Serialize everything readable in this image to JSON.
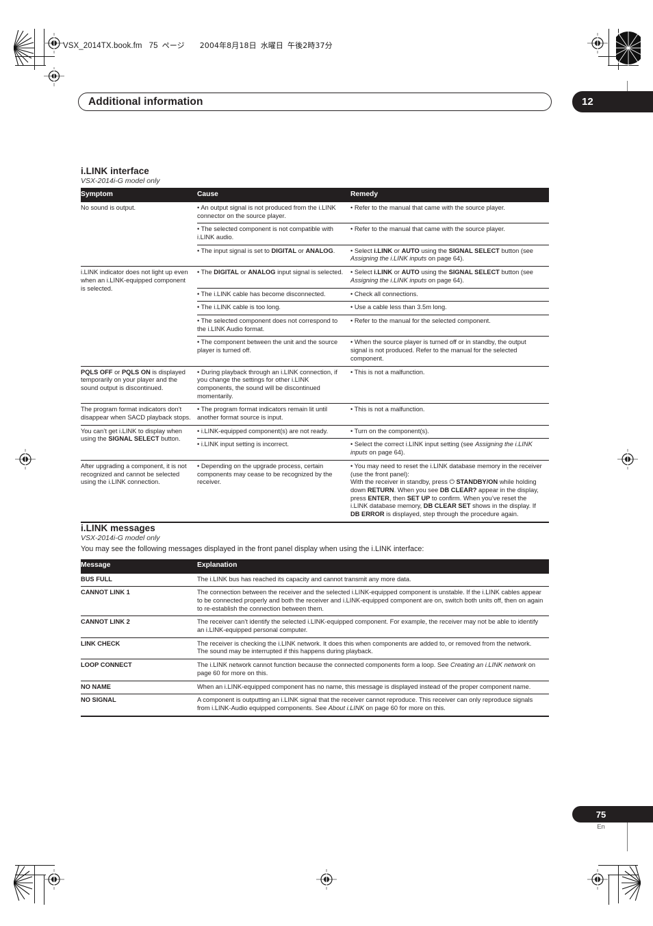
{
  "file_header": {
    "filename": "VSX_2014TX.book.fm",
    "page_label": "75",
    "page_unit": "ページ",
    "date": "2004年8月18日",
    "weekday": "水曜日",
    "time": "午後2時37分"
  },
  "chapter": {
    "title": "Additional information",
    "number": "12"
  },
  "sections": [
    {
      "heading": "i.LINK interface",
      "model_note": "VSX-2014i-G model only"
    },
    {
      "heading": "i.LINK messages",
      "model_note": "VSX-2014i-G model only",
      "lead": "You may see the following messages displayed in the front panel display when using the i.LINK interface:"
    }
  ],
  "troubleshooting_table": {
    "headers": [
      "Symptom",
      "Cause",
      "Remedy"
    ],
    "rows": [
      {
        "symptom": "No sound is output.",
        "entries": [
          {
            "cause": "• An output signal is not produced from the i.LINK connector on the source player.",
            "remedy": "• Refer to the manual that came with the source player."
          },
          {
            "cause": "• The selected component is not compatible with i.LINK audio.",
            "remedy": "• Refer to the manual that came with the source player."
          },
          {
            "cause_html": "• The input signal is set to <b>DIGITAL</b> or <b>ANALOG</b>.",
            "remedy_html": "• Select <b>i.LINK</b> or <b>AUTO</b> using the <b>SIGNAL SELECT</b> button (see <i>Assigning the i.LINK inputs</i> on page 64)."
          }
        ]
      },
      {
        "symptom": "i.LINK indicator does not light up even when an i.LINK-equipped component is selected.",
        "entries": [
          {
            "cause_html": "• The <b>DIGITAL</b> or <b>ANALOG</b> input signal is selected.",
            "remedy_html": "• Select <b>i.LINK</b> or <b>AUTO</b> using the <b>SIGNAL SELECT</b> button (see <i>Assigning the i.LINK inputs</i> on page 64)."
          },
          {
            "cause": "• The i.LINK cable has become disconnected.",
            "remedy": "• Check all connections."
          },
          {
            "cause": "• The i.LINK cable is too long.",
            "remedy": "• Use a cable less than 3.5m long."
          },
          {
            "cause": "• The selected component does not correspond to the i.LINK Audio format.",
            "remedy": "• Refer to the manual for the selected component."
          },
          {
            "cause": "• The component between the unit and the source player is turned off.",
            "remedy": "• When the source player is turned off or in standby, the output signal is not produced. Refer to the manual for the selected component."
          }
        ]
      },
      {
        "symptom_html": "<b>PQLS OFF</b> or <b>PQLS ON</b> is displayed temporarily on your player and the sound output is discontinued.",
        "entries": [
          {
            "cause": "• During playback through an i.LINK connection, if you change the settings for other i.LINK components, the sound will be discontinued momentarily.",
            "remedy": "• This is not a malfunction."
          }
        ]
      },
      {
        "symptom": "The program format indicators don’t disappear when SACD playback stops.",
        "entries": [
          {
            "cause": "• The program format indicators remain lit until another format source is input.",
            "remedy": "• This is not a malfunction."
          }
        ]
      },
      {
        "symptom_html": "You can’t get i.LINK to display when using the <b>SIGNAL SELECT</b> button.",
        "entries": [
          {
            "cause": "• i.LINK-equipped component(s) are not ready.",
            "remedy": "• Turn on the component(s)."
          },
          {
            "cause": "• i.LINK input setting is incorrect.",
            "remedy_html": "• Select the correct i.LINK input setting (see <i>Assigning the i.LINK inputs</i> on page 64)."
          }
        ]
      },
      {
        "symptom": "After upgrading a component, it is not recognized and cannot be selected using the i.LINK connection.",
        "entries": [
          {
            "cause": "• Depending on the upgrade process, certain components may cease to be recognized by the receiver.",
            "remedy_html": "• You may need to reset the i.LINK database memory in the receiver (use the front panel):<br>With the receiver in standby, press ⏻ <b>STANDBY/ON</b> while holding down <b>RETURN</b>. When you see <b>DB CLEAR?</b> appear in the display, press <b>ENTER</b>, then <b>SET UP</b> to confirm. When you’ve reset the i.LINK database memory, <b>DB CLEAR SET</b> shows in the display. If <b>DB ERROR</b> is displayed, step through the procedure again."
          }
        ]
      }
    ]
  },
  "messages_table": {
    "headers": [
      "Message",
      "Explanation"
    ],
    "rows": [
      {
        "message": "BUS FULL",
        "explanation": "The i.LINK bus has reached its capacity and cannot transmit any more data."
      },
      {
        "message": "CANNOT LINK 1",
        "explanation": "The connection between the receiver and the selected i.LINK-equipped component is unstable. If the i.LINK cables appear to be connected properly and both the receiver and i.LINK-equipped component are on, switch both units off, then on again to re-establish the connection between them."
      },
      {
        "message": "CANNOT LINK 2",
        "explanation": "The receiver can’t identify the selected i.LINK-equipped component. For example, the receiver may not be able to identify an i.LINK-equipped personal computer."
      },
      {
        "message": "LINK CHECK",
        "explanation": "The receiver is checking the i.LINK network. It does this when components are added to, or removed from the network. The sound may be interrupted if this happens during playback."
      },
      {
        "message": "LOOP CONNECT",
        "explanation_html": "The i.LINK network cannot function because the connected components form a loop. See <i>Creating an i.LINK network</i> on page 60 for more on this."
      },
      {
        "message": "NO NAME",
        "explanation": "When an i.LINK-equipped component has no name, this message is displayed instead of the proper component name."
      },
      {
        "message": "NO SIGNAL",
        "explanation_html": "A component is outputting an i.LINK signal that the receiver cannot reproduce. This receiver can only reproduce signals from i.LINK-Audio equipped components. See <i>About i.LINK</i> on page 60 for more on this."
      }
    ]
  },
  "footer": {
    "page_number": "75",
    "language_code": "En"
  },
  "colors": {
    "ink": "#231f20",
    "header_bar": "#231f20",
    "paper": "#ffffff"
  }
}
